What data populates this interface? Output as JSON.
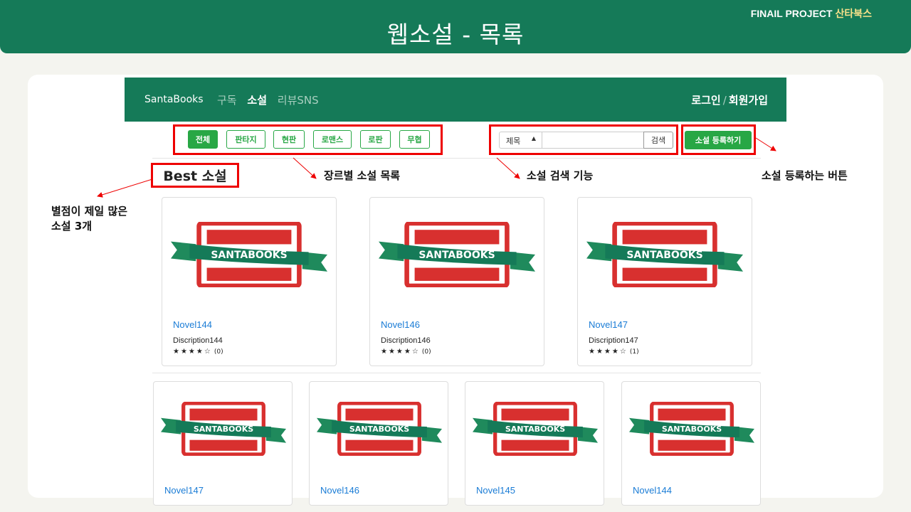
{
  "slide": {
    "title": "웹소설 - 목록",
    "project_label": "FINAIL PROJECT",
    "project_name": "산타북스"
  },
  "nav": {
    "brand": "SantaBooks",
    "menu": [
      "구독",
      "소설",
      "리뷰SNS"
    ],
    "active_menu": "소설",
    "login": "로그인",
    "separator": "/",
    "signup": "회원가입"
  },
  "genres": [
    "전체",
    "판타지",
    "현판",
    "로맨스",
    "로판",
    "무협"
  ],
  "active_genre": "전체",
  "search": {
    "select_value": "제목",
    "input_value": "",
    "button": "검색"
  },
  "register_button": "소설 등록하기",
  "best_title": "Best 소설",
  "annotations": {
    "genre_list": "장르별 소설 목록",
    "search": "소설 검색 기능",
    "register": "소설 등록하는 버튼",
    "best_line1": "별점이 제일 많은",
    "best_line2": "소설 3개"
  },
  "logo_text": "SANTABOOKS",
  "best_novels": [
    {
      "title": "Novel144",
      "desc": "Discription144",
      "stars": "★★★★☆",
      "count": "(0)"
    },
    {
      "title": "Novel146",
      "desc": "Discription146",
      "stars": "★★★★☆",
      "count": "(0)"
    },
    {
      "title": "Novel147",
      "desc": "Discription147",
      "stars": "★★★★☆",
      "count": "(1)"
    }
  ],
  "novels": [
    {
      "title": "Novel147"
    },
    {
      "title": "Novel146"
    },
    {
      "title": "Novel145"
    },
    {
      "title": "Novel144"
    }
  ],
  "colors": {
    "brand_green": "#157a58",
    "button_green": "#28a745",
    "highlight_red": "#ee0000",
    "link_blue": "#1a7cd6"
  }
}
